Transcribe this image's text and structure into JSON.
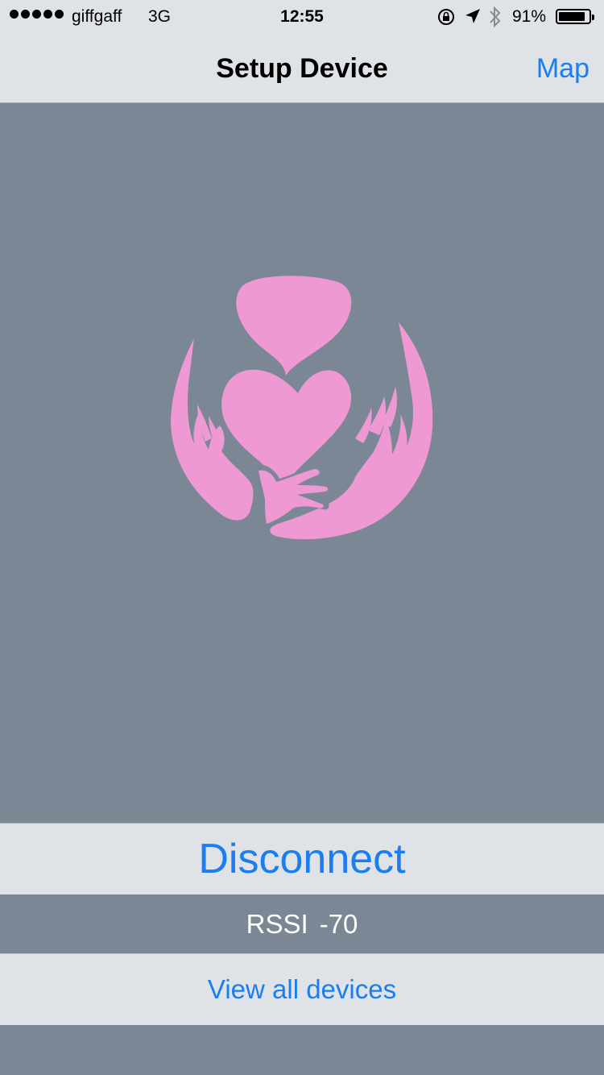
{
  "status_bar": {
    "carrier": "giffgaff",
    "network": "3G",
    "time": "12:55",
    "battery_percent": "91%",
    "battery_level": 0.91,
    "icons": [
      "signal-dots-icon",
      "rotation-lock-icon",
      "location-arrow-icon",
      "bluetooth-icon",
      "battery-icon"
    ]
  },
  "nav": {
    "title": "Setup Device",
    "right_button": "Map"
  },
  "logo": {
    "icon": "heart-hands-logo",
    "color": "#ee99d4"
  },
  "actions": {
    "disconnect": "Disconnect",
    "rssi_label": "RSSI",
    "rssi_value": "-70",
    "view_all": "View all devices"
  },
  "colors": {
    "accent": "#1a7df0",
    "background": "#7c8795",
    "bar": "#dfe2e7"
  }
}
